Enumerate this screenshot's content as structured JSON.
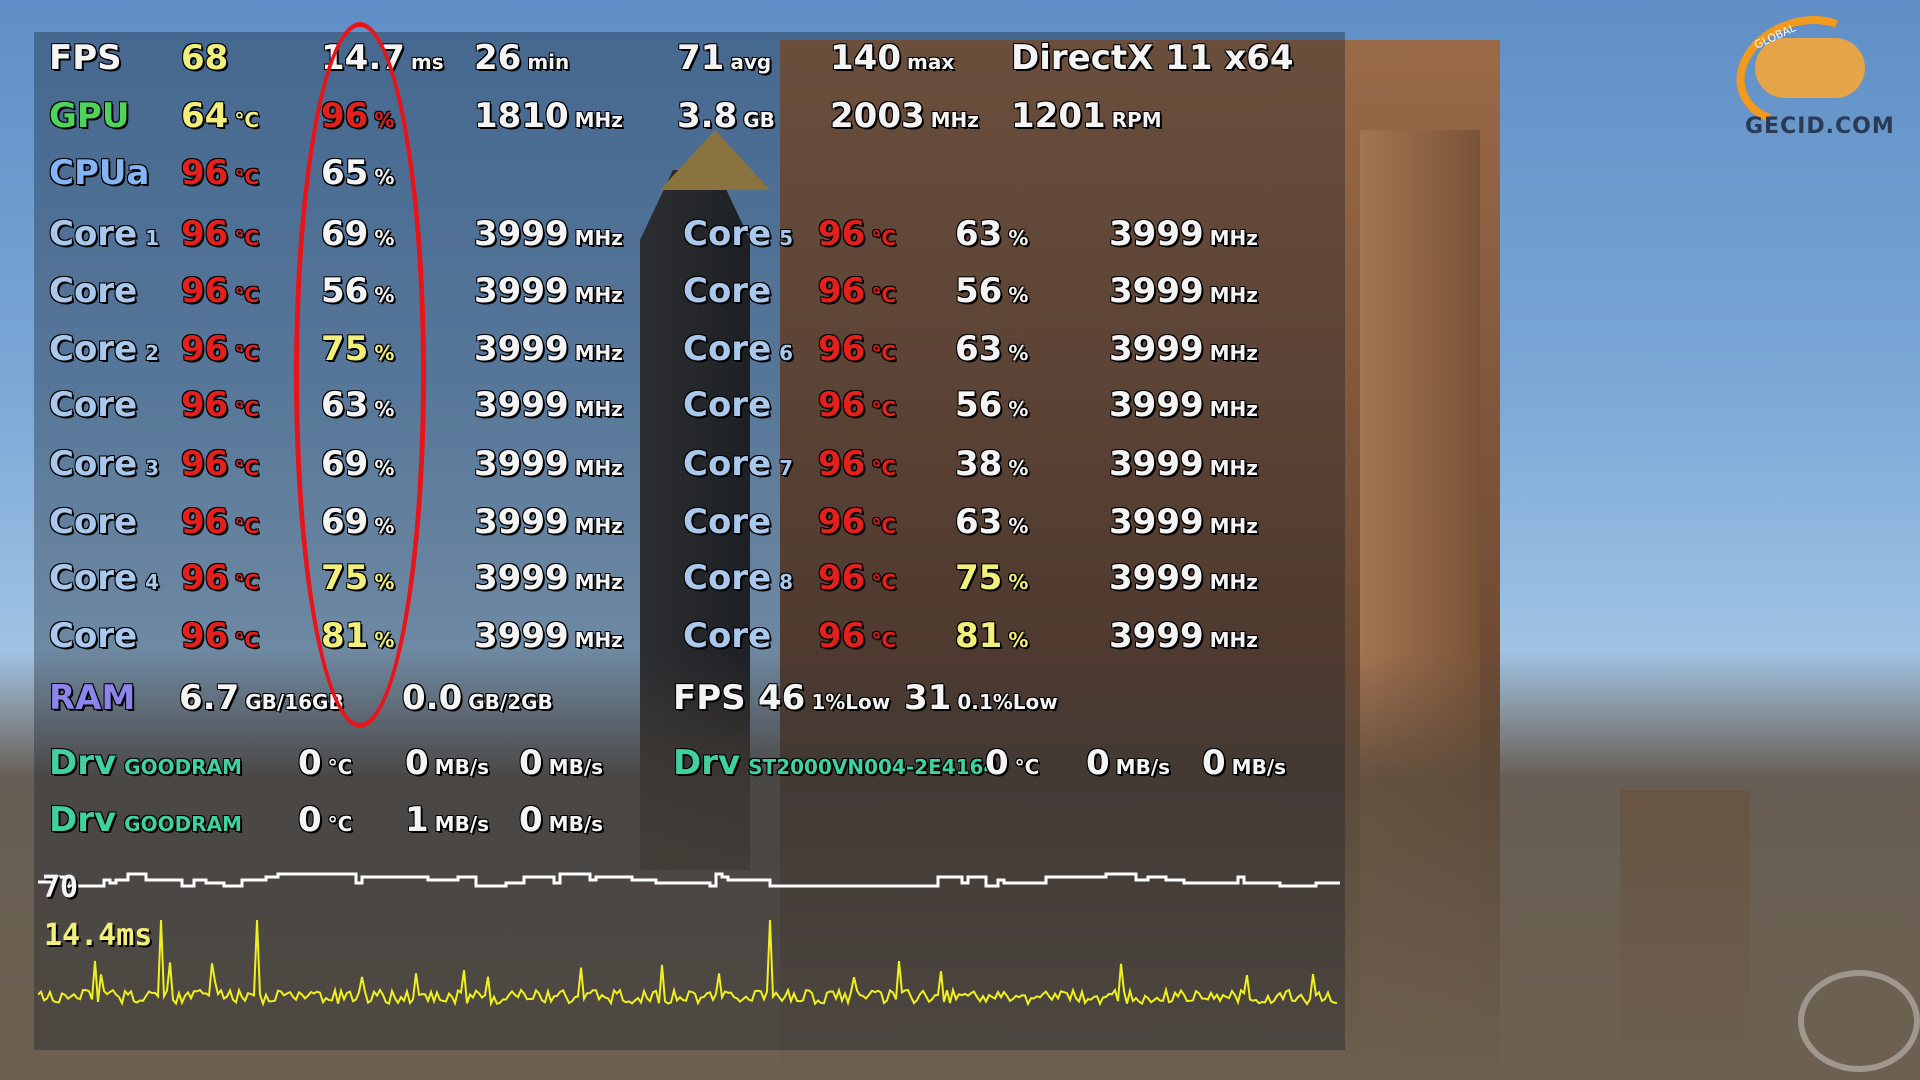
{
  "osd": {
    "fps_row": {
      "label": "FPS",
      "fps": "68",
      "frametime": "14.7",
      "frametime_unit": "ms",
      "min": "26",
      "min_unit": "min",
      "avg": "71",
      "avg_unit": "avg",
      "max": "140",
      "max_unit": "max",
      "api": "DirectX 11 x64"
    },
    "gpu_row": {
      "label": "GPU",
      "temp": "64",
      "temp_unit": "°C",
      "load": "96",
      "load_unit": "%",
      "core_clock": "1810",
      "core_clock_unit": "MHz",
      "vram": "3.8",
      "vram_unit": "GB",
      "mem_clock": "2003",
      "mem_clock_unit": "MHz",
      "fan": "1201",
      "fan_unit": "RPM"
    },
    "cpu_row": {
      "label": "CPUa",
      "temp": "96",
      "temp_unit": "°C",
      "load": "65",
      "load_unit": "%"
    },
    "cores_left": [
      {
        "label": "Core",
        "index": "1",
        "temp": "96",
        "temp_unit": "°C",
        "load": "69",
        "load_unit": "%",
        "clock": "3999",
        "clock_unit": "MHz"
      },
      {
        "label": "Core",
        "index": "",
        "temp": "96",
        "temp_unit": "°C",
        "load": "56",
        "load_unit": "%",
        "clock": "3999",
        "clock_unit": "MHz"
      },
      {
        "label": "Core",
        "index": "2",
        "temp": "96",
        "temp_unit": "°C",
        "load": "75",
        "load_unit": "%",
        "clock": "3999",
        "clock_unit": "MHz"
      },
      {
        "label": "Core",
        "index": "",
        "temp": "96",
        "temp_unit": "°C",
        "load": "63",
        "load_unit": "%",
        "clock": "3999",
        "clock_unit": "MHz"
      },
      {
        "label": "Core",
        "index": "3",
        "temp": "96",
        "temp_unit": "°C",
        "load": "69",
        "load_unit": "%",
        "clock": "3999",
        "clock_unit": "MHz"
      },
      {
        "label": "Core",
        "index": "",
        "temp": "96",
        "temp_unit": "°C",
        "load": "69",
        "load_unit": "%",
        "clock": "3999",
        "clock_unit": "MHz"
      },
      {
        "label": "Core",
        "index": "4",
        "temp": "96",
        "temp_unit": "°C",
        "load": "75",
        "load_unit": "%",
        "clock": "3999",
        "clock_unit": "MHz"
      },
      {
        "label": "Core",
        "index": "",
        "temp": "96",
        "temp_unit": "°C",
        "load": "81",
        "load_unit": "%",
        "clock": "3999",
        "clock_unit": "MHz"
      }
    ],
    "cores_right": [
      {
        "label": "Core",
        "index": "5",
        "temp": "96",
        "temp_unit": "°C",
        "load": "63",
        "load_unit": "%",
        "clock": "3999",
        "clock_unit": "MHz"
      },
      {
        "label": "Core",
        "index": "",
        "temp": "96",
        "temp_unit": "°C",
        "load": "56",
        "load_unit": "%",
        "clock": "3999",
        "clock_unit": "MHz"
      },
      {
        "label": "Core",
        "index": "6",
        "temp": "96",
        "temp_unit": "°C",
        "load": "63",
        "load_unit": "%",
        "clock": "3999",
        "clock_unit": "MHz"
      },
      {
        "label": "Core",
        "index": "",
        "temp": "96",
        "temp_unit": "°C",
        "load": "56",
        "load_unit": "%",
        "clock": "3999",
        "clock_unit": "MHz"
      },
      {
        "label": "Core",
        "index": "7",
        "temp": "96",
        "temp_unit": "°C",
        "load": "38",
        "load_unit": "%",
        "clock": "3999",
        "clock_unit": "MHz"
      },
      {
        "label": "Core",
        "index": "",
        "temp": "96",
        "temp_unit": "°C",
        "load": "63",
        "load_unit": "%",
        "clock": "3999",
        "clock_unit": "MHz"
      },
      {
        "label": "Core",
        "index": "8",
        "temp": "96",
        "temp_unit": "°C",
        "load": "75",
        "load_unit": "%",
        "clock": "3999",
        "clock_unit": "MHz"
      },
      {
        "label": "Core",
        "index": "",
        "temp": "96",
        "temp_unit": "°C",
        "load": "81",
        "load_unit": "%",
        "clock": "3999",
        "clock_unit": "MHz"
      }
    ],
    "ram_row": {
      "label": "RAM",
      "used": "6.7",
      "used_unit": "GB/16GB",
      "vmem": "0.0",
      "vmem_unit": "GB/2GB"
    },
    "lows_row": {
      "label": "FPS",
      "low1": "46",
      "low1_unit": "1%Low",
      "low01": "31",
      "low01_unit": "0.1%Low"
    },
    "drives": [
      {
        "label": "Drv",
        "name": "GOODRAM",
        "temp": "0",
        "temp_unit": "°C",
        "read": "0",
        "read_unit": "MB/s",
        "write": "0",
        "write_unit": "MB/s"
      },
      {
        "label": "Drv",
        "name": "ST2000VN004-2E4164",
        "temp": "0",
        "temp_unit": "°C",
        "read": "0",
        "read_unit": "MB/s",
        "write": "0",
        "write_unit": "MB/s"
      },
      {
        "label": "Drv",
        "name": "GOODRAM",
        "temp": "0",
        "temp_unit": "°C",
        "read": "1",
        "read_unit": "MB/s",
        "write": "0",
        "write_unit": "MB/s"
      }
    ],
    "graph": {
      "fps_label": "70",
      "frametime_label": "14.4ms",
      "fps_color": "#ffffff",
      "frametime_color": "#f0f020"
    }
  },
  "logo": {
    "text": "GECID.COM",
    "arc_text": "GLOBAL"
  },
  "colors": {
    "highlight_ellipse": "#e8141a",
    "temp_hot": "#e3201c",
    "gpu_label": "#4fd35a",
    "cpu_label": "#84b4f4",
    "ram_label": "#8d84ec",
    "drive_label": "#3fd2a0"
  }
}
